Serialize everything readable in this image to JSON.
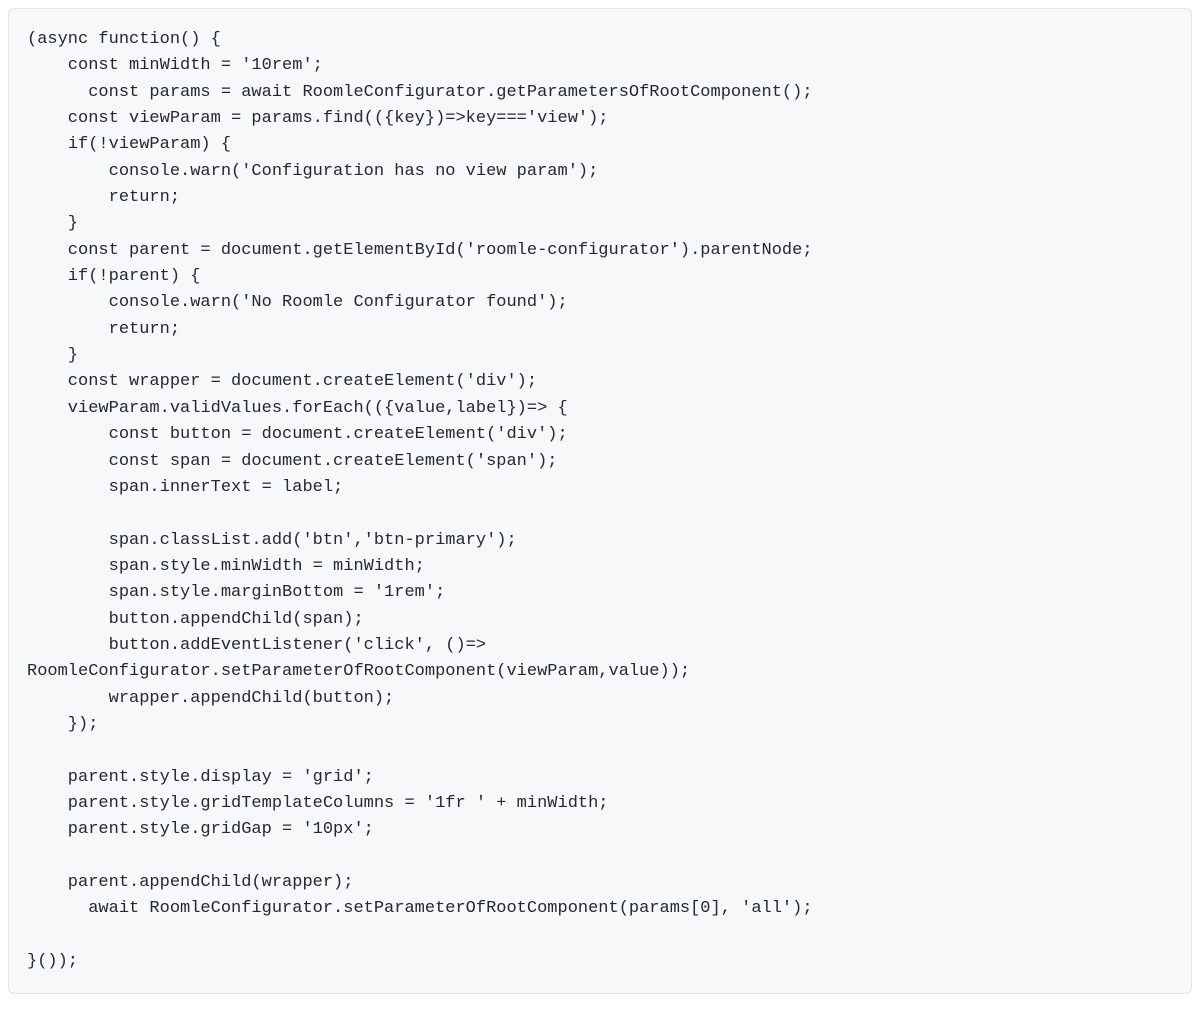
{
  "code_lines": [
    "(async function() {",
    "    const minWidth = '10rem';",
    "      const params = await RoomleConfigurator.getParametersOfRootComponent();",
    "    const viewParam = params.find(({key})=>key==='view');",
    "    if(!viewParam) {",
    "        console.warn('Configuration has no view param');",
    "        return;",
    "    }",
    "    const parent = document.getElementById('roomle-configurator').parentNode;",
    "    if(!parent) {",
    "        console.warn('No Roomle Configurator found');",
    "        return;",
    "    }",
    "    const wrapper = document.createElement('div');",
    "    viewParam.validValues.forEach(({value,label})=> {",
    "        const button = document.createElement('div');",
    "        const span = document.createElement('span');",
    "        span.innerText = label;",
    "",
    "        span.classList.add('btn','btn-primary');",
    "        span.style.minWidth = minWidth;",
    "        span.style.marginBottom = '1rem';",
    "        button.appendChild(span);",
    "        button.addEventListener('click', ()=>",
    "RoomleConfigurator.setParameterOfRootComponent(viewParam,value));",
    "        wrapper.appendChild(button);",
    "    });",
    "",
    "    parent.style.display = 'grid';",
    "    parent.style.gridTemplateColumns = '1fr ' + minWidth;",
    "    parent.style.gridGap = '10px';",
    "",
    "    parent.appendChild(wrapper);",
    "      await RoomleConfigurator.setParameterOfRootComponent(params[0], 'all');",
    "",
    "}());"
  ]
}
